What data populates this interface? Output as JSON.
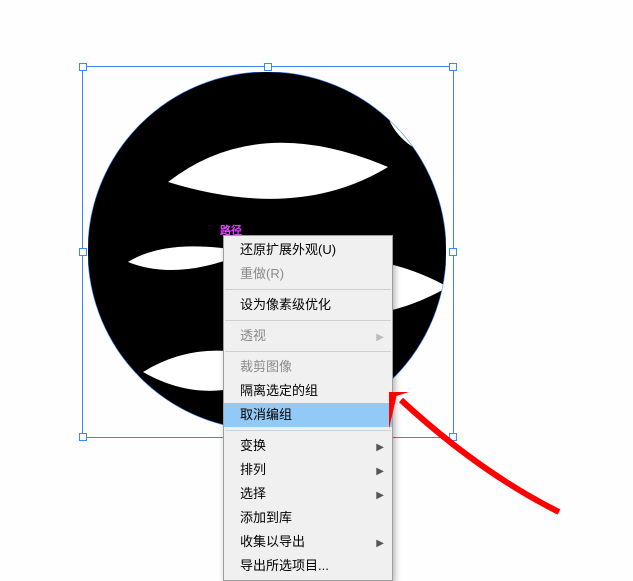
{
  "canvas_object_label": "路径",
  "menu": {
    "items": [
      {
        "label": "还原扩展外观(U)",
        "enabled": true,
        "submenu": false
      },
      {
        "label": "重做(R)",
        "enabled": false,
        "submenu": false
      },
      {
        "sep": true
      },
      {
        "label": "设为像素级优化",
        "enabled": true,
        "submenu": false
      },
      {
        "sep": true
      },
      {
        "label": "透视",
        "enabled": false,
        "submenu": true
      },
      {
        "sep": true
      },
      {
        "label": "裁剪图像",
        "enabled": false,
        "submenu": false
      },
      {
        "label": "隔离选定的组",
        "enabled": true,
        "submenu": false
      },
      {
        "label": "取消编组",
        "enabled": true,
        "submenu": false,
        "highlight": true
      },
      {
        "sep": true
      },
      {
        "label": "变换",
        "enabled": true,
        "submenu": true
      },
      {
        "label": "排列",
        "enabled": true,
        "submenu": true
      },
      {
        "label": "选择",
        "enabled": true,
        "submenu": true
      },
      {
        "label": "添加到库",
        "enabled": true,
        "submenu": false
      },
      {
        "label": "收集以导出",
        "enabled": true,
        "submenu": true
      },
      {
        "label": "导出所选项目...",
        "enabled": true,
        "submenu": false
      }
    ]
  },
  "colors": {
    "selection": "#3a86ff",
    "menu_highlight": "#91c9f7",
    "label": "#e040fb",
    "annot_arrow": "#ff0000"
  }
}
